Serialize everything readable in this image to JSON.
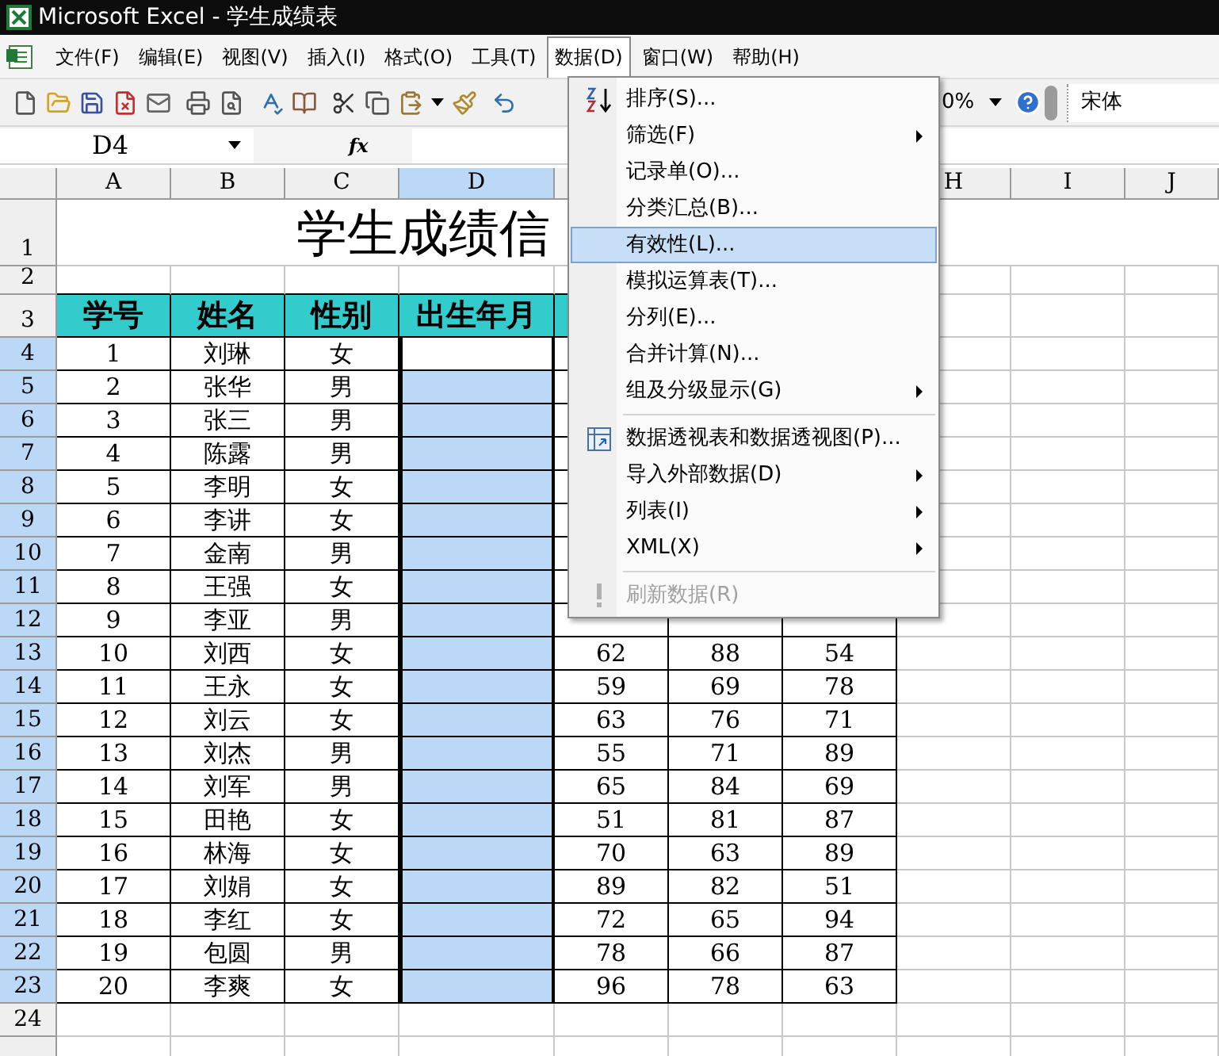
{
  "window": {
    "title": "Microsoft Excel - 学生成绩表"
  },
  "menu_bar": [
    {
      "label": "文件(F)",
      "selected": false
    },
    {
      "label": "编辑(E)",
      "selected": false
    },
    {
      "label": "视图(V)",
      "selected": false
    },
    {
      "label": "插入(I)",
      "selected": false
    },
    {
      "label": "格式(O)",
      "selected": false
    },
    {
      "label": "工具(T)",
      "selected": false
    },
    {
      "label": "数据(D)",
      "selected": true
    },
    {
      "label": "窗口(W)",
      "selected": false
    },
    {
      "label": "帮助(H)",
      "selected": false
    }
  ],
  "toolbar": {
    "zoom": "0%",
    "font": "宋体"
  },
  "formula_bar": {
    "name_box": "D4",
    "fx": "fx"
  },
  "sheet": {
    "columns": [
      {
        "label": "A",
        "selected": false
      },
      {
        "label": "B",
        "selected": false
      },
      {
        "label": "C",
        "selected": false
      },
      {
        "label": "D",
        "selected": true
      },
      {},
      {},
      {},
      {
        "label": "H",
        "selected": false
      },
      {
        "label": "I",
        "selected": false
      },
      {
        "label": "J",
        "selected": false
      }
    ],
    "title_row": {
      "number": "1",
      "title": "学生成绩信"
    },
    "blank_row": {
      "number": "2"
    },
    "header_row": {
      "number": "3",
      "cells": [
        "学号",
        "姓名",
        "性别",
        "出生年月"
      ]
    },
    "rows": [
      {
        "number": "4",
        "selected": true,
        "active": true,
        "cells": [
          "1",
          "刘琳",
          "女"
        ]
      },
      {
        "number": "5",
        "selected": true,
        "active": false,
        "cells": [
          "2",
          "张华",
          "男"
        ]
      },
      {
        "number": "6",
        "selected": true,
        "active": false,
        "cells": [
          "3",
          "张三",
          "男"
        ]
      },
      {
        "number": "7",
        "selected": true,
        "active": false,
        "cells": [
          "4",
          "陈露",
          "男"
        ]
      },
      {
        "number": "8",
        "selected": true,
        "active": false,
        "cells": [
          "5",
          "李明",
          "女"
        ]
      },
      {
        "number": "9",
        "selected": true,
        "active": false,
        "cells": [
          "6",
          "李讲",
          "女"
        ]
      },
      {
        "number": "10",
        "selected": true,
        "active": false,
        "cells": [
          "7",
          "金南",
          "男"
        ]
      },
      {
        "number": "11",
        "selected": true,
        "active": false,
        "cells": [
          "8",
          "王强",
          "女"
        ]
      },
      {
        "number": "12",
        "selected": true,
        "active": false,
        "cells": [
          "9",
          "李亚",
          "男"
        ]
      },
      {
        "number": "13",
        "selected": true,
        "active": false,
        "cells": [
          "10",
          "刘西",
          "女"
        ],
        "scores": [
          "62",
          "88",
          "54"
        ]
      },
      {
        "number": "14",
        "selected": true,
        "active": false,
        "cells": [
          "11",
          "王永",
          "女"
        ],
        "scores": [
          "59",
          "69",
          "78"
        ]
      },
      {
        "number": "15",
        "selected": true,
        "active": false,
        "cells": [
          "12",
          "刘云",
          "女"
        ],
        "scores": [
          "63",
          "76",
          "71"
        ]
      },
      {
        "number": "16",
        "selected": true,
        "active": false,
        "cells": [
          "13",
          "刘杰",
          "男"
        ],
        "scores": [
          "55",
          "71",
          "89"
        ]
      },
      {
        "number": "17",
        "selected": true,
        "active": false,
        "cells": [
          "14",
          "刘军",
          "男"
        ],
        "scores": [
          "65",
          "84",
          "69"
        ]
      },
      {
        "number": "18",
        "selected": true,
        "active": false,
        "cells": [
          "15",
          "田艳",
          "女"
        ],
        "scores": [
          "51",
          "81",
          "87"
        ]
      },
      {
        "number": "19",
        "selected": true,
        "active": false,
        "cells": [
          "16",
          "林海",
          "女"
        ],
        "scores": [
          "70",
          "63",
          "89"
        ]
      },
      {
        "number": "20",
        "selected": true,
        "active": false,
        "cells": [
          "17",
          "刘娟",
          "女"
        ],
        "scores": [
          "89",
          "82",
          "51"
        ]
      },
      {
        "number": "21",
        "selected": true,
        "active": false,
        "cells": [
          "18",
          "李红",
          "女"
        ],
        "scores": [
          "72",
          "65",
          "94"
        ]
      },
      {
        "number": "22",
        "selected": true,
        "active": false,
        "cells": [
          "19",
          "包圆",
          "男"
        ],
        "scores": [
          "78",
          "66",
          "87"
        ]
      },
      {
        "number": "23",
        "selected": true,
        "active": false,
        "cells": [
          "20",
          "李爽",
          "女"
        ],
        "scores": [
          "96",
          "78",
          "63"
        ]
      }
    ],
    "empty_rows": [
      "24"
    ]
  },
  "data_menu": [
    {
      "label": "排序(S)...",
      "kind": "sort",
      "selected": false,
      "disabled": false,
      "separator": false
    },
    {
      "label": "筛选(F)",
      "kind": "submenu",
      "selected": false,
      "disabled": false,
      "separator": false
    },
    {
      "label": "记录单(O)...",
      "kind": "command",
      "selected": false,
      "disabled": false,
      "separator": false
    },
    {
      "label": "分类汇总(B)...",
      "kind": "command",
      "selected": false,
      "disabled": false,
      "separator": false
    },
    {
      "label": "有效性(L)...",
      "kind": "command",
      "selected": true,
      "disabled": false,
      "separator": false
    },
    {
      "label": "模拟运算表(T)...",
      "kind": "command",
      "selected": false,
      "disabled": false,
      "separator": false
    },
    {
      "label": "分列(E)...",
      "kind": "command",
      "selected": false,
      "disabled": false,
      "separator": false
    },
    {
      "label": "合并计算(N)...",
      "kind": "command",
      "selected": false,
      "disabled": false,
      "separator": false
    },
    {
      "label": "组及分级显示(G)",
      "kind": "submenu",
      "selected": false,
      "disabled": false,
      "separator": false
    },
    {
      "label": "数据透视表和数据透视图(P)...",
      "kind": "pivot",
      "selected": false,
      "disabled": false,
      "separator": true
    },
    {
      "label": "导入外部数据(D)",
      "kind": "submenu",
      "selected": false,
      "disabled": false,
      "separator": false
    },
    {
      "label": "列表(I)",
      "kind": "submenu",
      "selected": false,
      "disabled": false,
      "separator": false
    },
    {
      "label": "XML(X)",
      "kind": "submenu",
      "selected": false,
      "disabled": false,
      "separator": false
    },
    {
      "label": "刷新数据(R)",
      "kind": "refresh",
      "selected": false,
      "disabled": true,
      "separator": true
    }
  ]
}
